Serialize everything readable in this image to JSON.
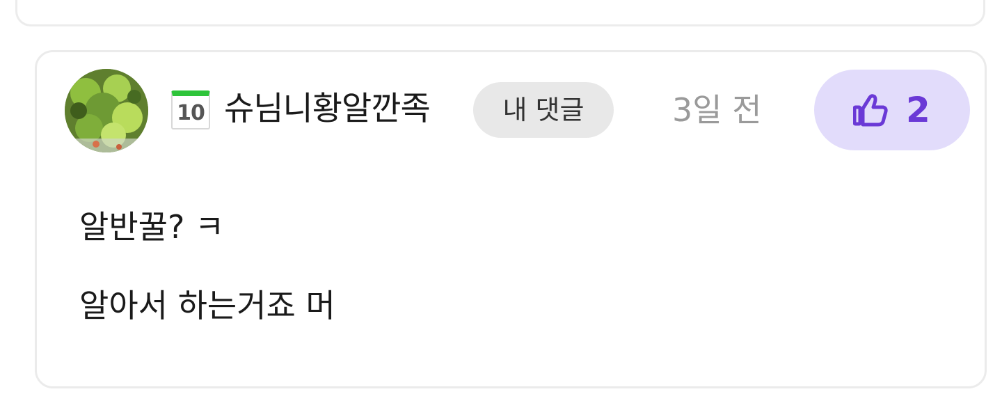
{
  "comment": {
    "author": {
      "avatar": "avatar-photo-green-salad",
      "level": "10",
      "level_badge_color": "#2ec43a",
      "username": "슈님니황알깐족"
    },
    "my_comment_tag": "내 댓글",
    "time": "3일 전",
    "like": {
      "icon": "thumbs-up-icon",
      "count": "2",
      "accent_color": "#6a39d6",
      "background_color": "#e2dcfb"
    },
    "body_lines": [
      "알반꿀? ㅋ",
      "알아서 하는거죠 머"
    ]
  }
}
